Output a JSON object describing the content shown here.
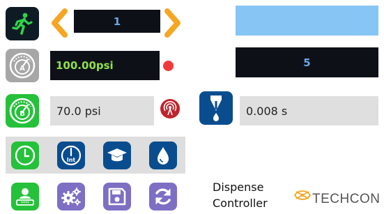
{
  "step": {
    "value": "1",
    "icon": "running-man-icon"
  },
  "pressure_a": {
    "value": "100.00psi",
    "indicator_color": "#f03a3a"
  },
  "pressure_b": {
    "value": "70.0 psi"
  },
  "dispense_time": {
    "value": "0.008 s"
  },
  "right_panel": {
    "counter": "5",
    "top_color": "#87c5f5"
  },
  "toolbar_row1": [
    "clock-icon",
    "interval-clock-icon",
    "graduation-cap-icon",
    "drop-icon"
  ],
  "toolbar_row2": [
    "operator-login-icon",
    "settings-gears-icon",
    "save-icon",
    "refresh-icon"
  ],
  "footer": {
    "line1": "Dispense",
    "line2": "Controller",
    "brand": "TECHCON"
  },
  "colors": {
    "green": "#25c13a",
    "navy": "#0a4d8f",
    "orange": "#f5a623",
    "purple": "#7e6fc4",
    "grey_icon": "#a7a7a7"
  }
}
